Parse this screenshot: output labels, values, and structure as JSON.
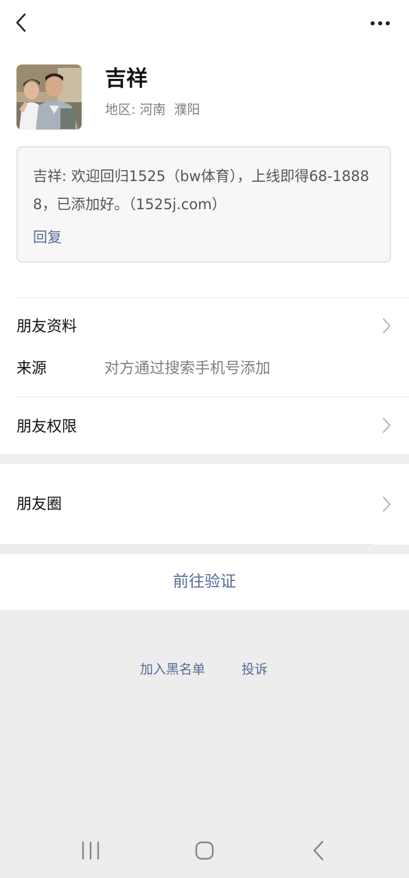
{
  "header": {
    "back_icon": "chevron-left-icon",
    "more_icon": "more-dots-icon"
  },
  "profile": {
    "name": "吉祥",
    "region_label": "地区:",
    "region_value": "河南  濮阳"
  },
  "message": {
    "text": "吉祥: 欢迎回归1525（bw体育），上线即得68-18888，已添加好。（1525j.com）",
    "reply_label": "回复"
  },
  "rows": {
    "friend_info": "朋友资料",
    "source_label": "来源",
    "source_value": "对方通过搜索手机号添加",
    "permissions": "朋友权限",
    "moments": "朋友圈"
  },
  "actions": {
    "verify": "前往验证",
    "blacklist": "加入黑名单",
    "report": "投诉"
  },
  "colors": {
    "link": "#576b95",
    "background": "#ededed",
    "card": "#ffffff"
  }
}
